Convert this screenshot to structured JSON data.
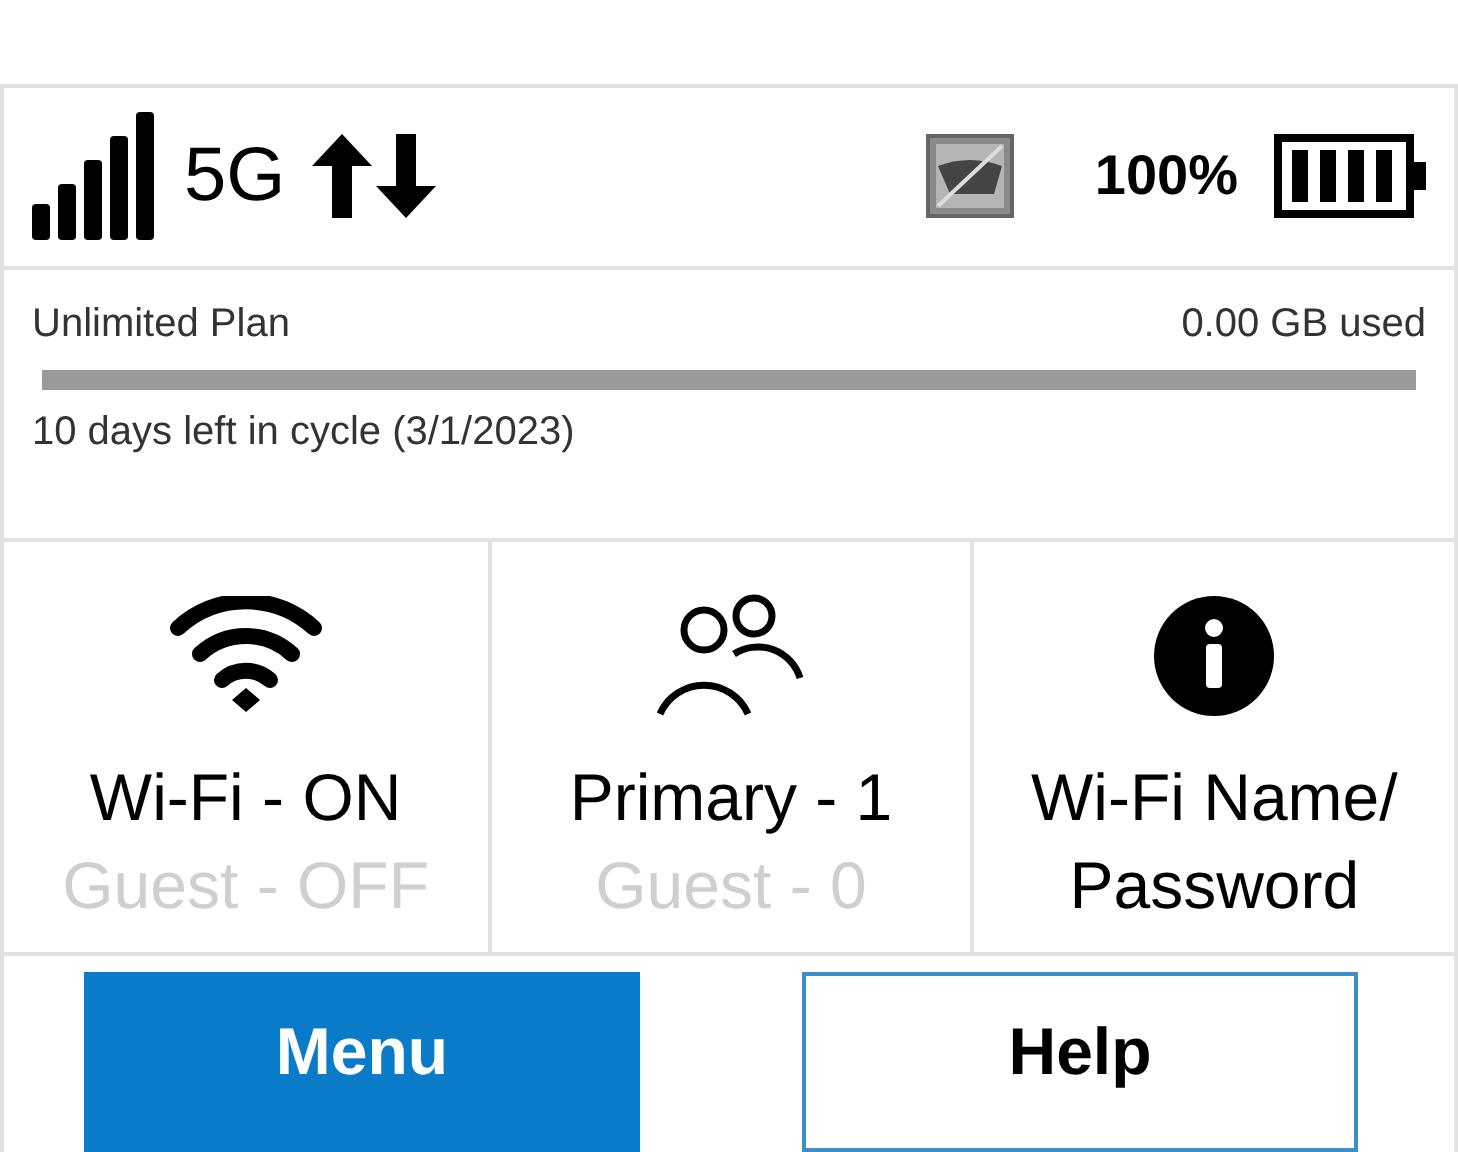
{
  "status_bar": {
    "network": "5G",
    "battery": "100%"
  },
  "plan": {
    "name": "Unlimited Plan",
    "usage": "0.00 GB used",
    "level": 0,
    "cycle": "10 days left in cycle (3/1/2023)"
  },
  "tiles": [
    {
      "kind": "wifi",
      "line1": "Wi-Fi - ON",
      "line2": "Guest - OFF",
      "line2_dim": true
    },
    {
      "kind": "users",
      "line1": "Primary - 1",
      "line2": "Guest - 0",
      "line2_dim": true
    },
    {
      "kind": "info",
      "line1": "Wi-Fi Name/",
      "line2": "Password",
      "line2_dim": false
    }
  ],
  "buttons": [
    {
      "label": "Menu",
      "kind": "primary"
    },
    {
      "label": "Help",
      "kind": "secondary"
    }
  ]
}
